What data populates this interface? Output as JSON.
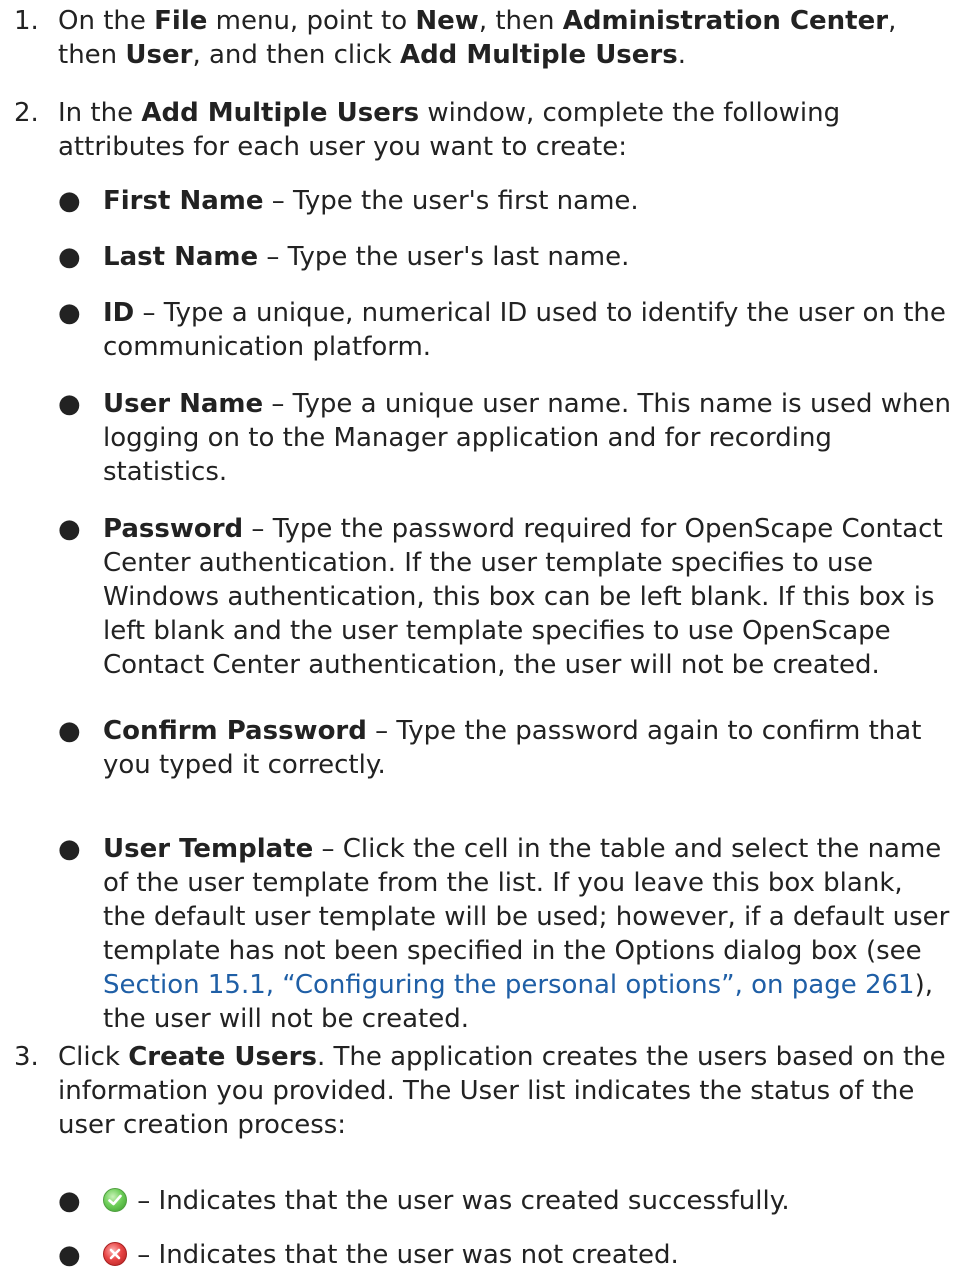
{
  "steps": [
    {
      "num": "1.",
      "p1": "On the ",
      "b1": "File",
      "p2": " menu, point to ",
      "b2": "New",
      "p3": ", then ",
      "b3": "Administration Center",
      "p4": ", then ",
      "b4": "User",
      "p5": ", and then click ",
      "b5": "Add Multiple Users",
      "p6": "."
    },
    {
      "num": "2.",
      "p1": "In the ",
      "b1": "Add Multiple Users",
      "p2": " window, complete the following attributes for each user you want to create:"
    },
    {
      "num": "3.",
      "p1": "Click ",
      "b1": "Create Users",
      "p2": ". The application creates the users based on the information you provided. The User list indicates the status of the user creation process:"
    }
  ],
  "bullet_glyph": "●",
  "attributes": [
    {
      "term": "First Name",
      "desc": " – Type the user's first name."
    },
    {
      "term": "Last Name",
      "desc": " – Type the user's last name."
    },
    {
      "term": "ID",
      "desc": " – Type a unique, numerical ID used to identify the user on the communication platform."
    },
    {
      "term": "User Name",
      "desc": " – Type a unique user name. This name is used when logging on to the Manager application and for recording statistics."
    },
    {
      "term": "Password",
      "desc": " – Type the password required for OpenScape Contact Center authentication. If the user template specifies to use Windows authentication, this box can be left blank. If this box is left blank and the user template specifies to use OpenScape Contact Center authentication, the user will not be created."
    },
    {
      "term": "Confirm Password",
      "desc": " – Type the password again to confirm that you typed it correctly."
    },
    {
      "term": "User Template",
      "desc": " – Click the cell in the table and select the name of the user template from the list. If you leave this box blank, the default user template will be used; however, if a default user template has not been specified in the Options dialog box (see ",
      "link": "Section 15.1, “Configuring the personal options”, on page 261",
      "tail": "), the user will not be created."
    }
  ],
  "statuses": [
    {
      "icon": "success-check-icon",
      "desc": " – Indicates that the user was created successfully."
    },
    {
      "icon": "failure-x-icon",
      "desc": " – Indicates that the user was not created."
    }
  ],
  "colors": {
    "text": "#222222",
    "link": "#1f5fa6",
    "success": "#4caf3a",
    "failure": "#d83030"
  }
}
